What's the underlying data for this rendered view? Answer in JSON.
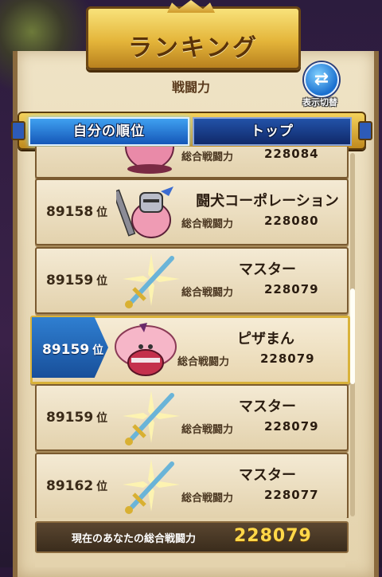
{
  "banner": {
    "title": "ランキング"
  },
  "section": {
    "label": "戦闘力"
  },
  "switch_button": {
    "label": "表示切替",
    "icon": "swap-arrows-icon"
  },
  "tabs": [
    {
      "label": "自分の順位",
      "active": true
    },
    {
      "label": "トップ",
      "active": false
    }
  ],
  "rows": [
    {
      "rank": "",
      "rank_unit": "",
      "name": "",
      "power_label": "総合戦闘力",
      "power": "228084",
      "avatar": "pink-blob-monster",
      "is_self": false
    },
    {
      "rank": "89158",
      "rank_unit": "位",
      "name": "闘犬コーポレーション",
      "power_label": "総合戦闘力",
      "power": "228080",
      "avatar": "pink-knight-monster",
      "is_self": false
    },
    {
      "rank": "89159",
      "rank_unit": "位",
      "name": "マスター",
      "power_label": "総合戦闘力",
      "power": "228079",
      "avatar": "sword-icon",
      "is_self": false
    },
    {
      "rank": "89159",
      "rank_unit": "位",
      "name": "ピザまん",
      "power_label": "総合戦闘力",
      "power": "228079",
      "avatar": "pink-fluffy-monster",
      "is_self": true
    },
    {
      "rank": "89159",
      "rank_unit": "位",
      "name": "マスター",
      "power_label": "総合戦闘力",
      "power": "228079",
      "avatar": "sword-icon",
      "is_self": false
    },
    {
      "rank": "89162",
      "rank_unit": "位",
      "name": "マスター",
      "power_label": "総合戦闘力",
      "power": "228077",
      "avatar": "sword-icon",
      "is_self": false
    }
  ],
  "footer": {
    "label": "現在のあなたの総合戦闘力",
    "value": "228079"
  },
  "colors": {
    "gold": "#ffd84a",
    "tab_active": "#1a6fcf",
    "parchment": "#efe3c5"
  }
}
